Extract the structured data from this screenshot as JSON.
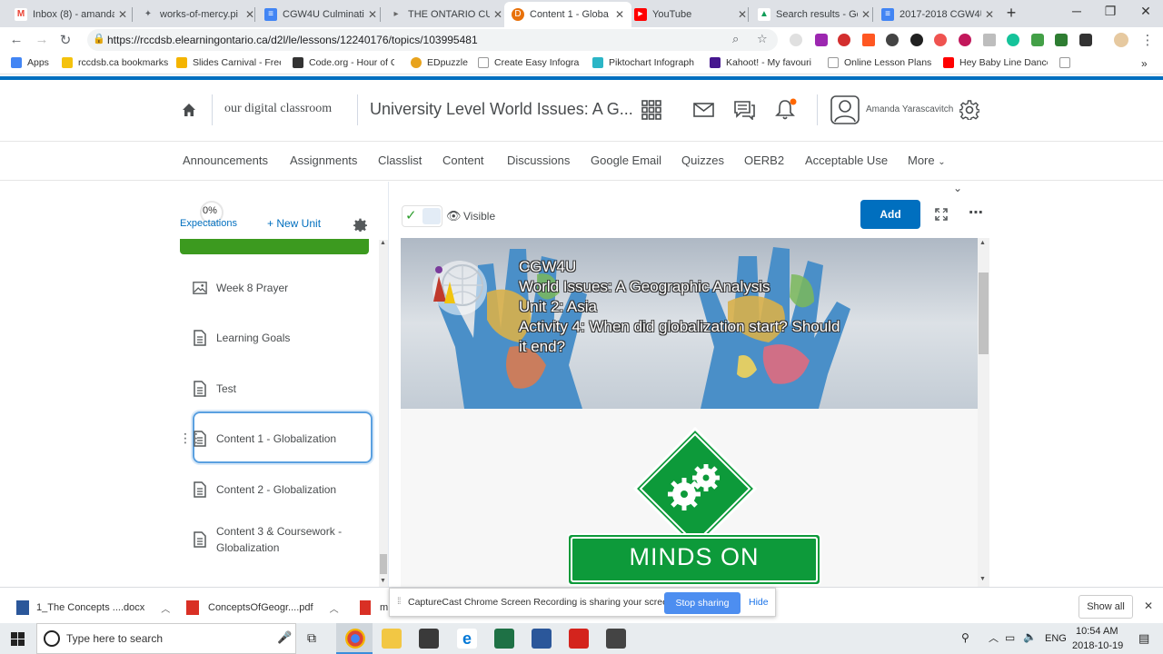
{
  "browser": {
    "tabs": [
      {
        "title": "Inbox (8) - amanda",
        "color": "#ea4335",
        "glyph": "M"
      },
      {
        "title": "works-of-mercy.pi",
        "color": "#5f6368",
        "glyph": "✦"
      },
      {
        "title": "CGW4U Culminati",
        "color": "#4285f4",
        "glyph": "≡"
      },
      {
        "title": "THE ONTARIO CU",
        "color": "#9aa0a6",
        "glyph": "▸"
      },
      {
        "title": "Content 1 - Globa",
        "color": "#e8710a",
        "glyph": "D"
      },
      {
        "title": "YouTube",
        "color": "#ff0000",
        "glyph": "▶"
      },
      {
        "title": "Search results - Go",
        "color": "#0f9d58",
        "glyph": "▲"
      },
      {
        "title": "2017-2018 CGW4U",
        "color": "#4285f4",
        "glyph": "≡"
      }
    ],
    "url": "https://rccdsb.elearningontario.ca/d2l/le/lessons/12240176/topics/103995481",
    "bookmarks": [
      {
        "label": "Apps",
        "color": "#4285f4"
      },
      {
        "label": "rccdsb.ca bookmarks",
        "color": "#f4c20d"
      },
      {
        "label": "Slides Carnival - Free",
        "color": "#f4b400"
      },
      {
        "label": "Code.org - Hour of C",
        "color": "#333333"
      },
      {
        "label": "EDpuzzle",
        "color": "#e8a31d"
      },
      {
        "label": "Create Easy Infograp",
        "color": "#ffffff"
      },
      {
        "label": "Piktochart Infograph",
        "color": "#2bb5c6"
      },
      {
        "label": "Kahoot! - My favouri",
        "color": "#46178f"
      },
      {
        "label": "Online Lesson Plans",
        "color": "#ffffff"
      },
      {
        "label": "Hey Baby Line Dance",
        "color": "#ff0000"
      }
    ]
  },
  "header": {
    "org_name": "our digital classroom",
    "course_title": "University Level World Issues: A G...",
    "user_name": "Amanda Yarascavitch"
  },
  "nav": {
    "items": [
      "Announcements",
      "Assignments",
      "Classlist",
      "Content",
      "Discussions",
      "Google Email",
      "Quizzes",
      "OERB2",
      "Acceptable Use"
    ],
    "more_label": "More"
  },
  "left_panel": {
    "progress": "0%",
    "expectations_label": "Expectations",
    "new_unit_label": "+ New Unit",
    "items": [
      {
        "label": "Week 8 Prayer",
        "type": "image"
      },
      {
        "label": "Learning Goals",
        "type": "doc"
      },
      {
        "label": "Test",
        "type": "doc"
      },
      {
        "label": "Content 1 - Globalization",
        "type": "doc"
      },
      {
        "label": "Content 2 - Globalization",
        "type": "doc"
      },
      {
        "label": "Content 3 & Coursework - Globalization",
        "type": "doc"
      }
    ]
  },
  "toolbar": {
    "visible_label": "Visible",
    "add_label": "Add"
  },
  "content": {
    "banner_lines": [
      "CGW4U",
      "World Issues: A Geographic Analysis",
      "Unit 2: Asia",
      "Activity 4: When did globalization start? Should",
      "it end?"
    ],
    "minds_on_label": "MINDS ON"
  },
  "downloads": {
    "items": [
      "1_The Concepts ....docx",
      "ConceptsOfGeogr....pdf",
      "m"
    ],
    "show_all_label": "Show all"
  },
  "sharing": {
    "message": "CaptureCast Chrome Screen Recording is sharing your screen.",
    "stop_label": "Stop sharing",
    "hide_label": "Hide"
  },
  "taskbar": {
    "search_placeholder": "Type here to search",
    "lang": "ENG",
    "time": "10:54 AM",
    "date": "2018-10-19"
  },
  "colors": {
    "d2l_blue": "#006fbf",
    "green": "#0d9a3a",
    "selected_border": "#5aa0e0"
  }
}
